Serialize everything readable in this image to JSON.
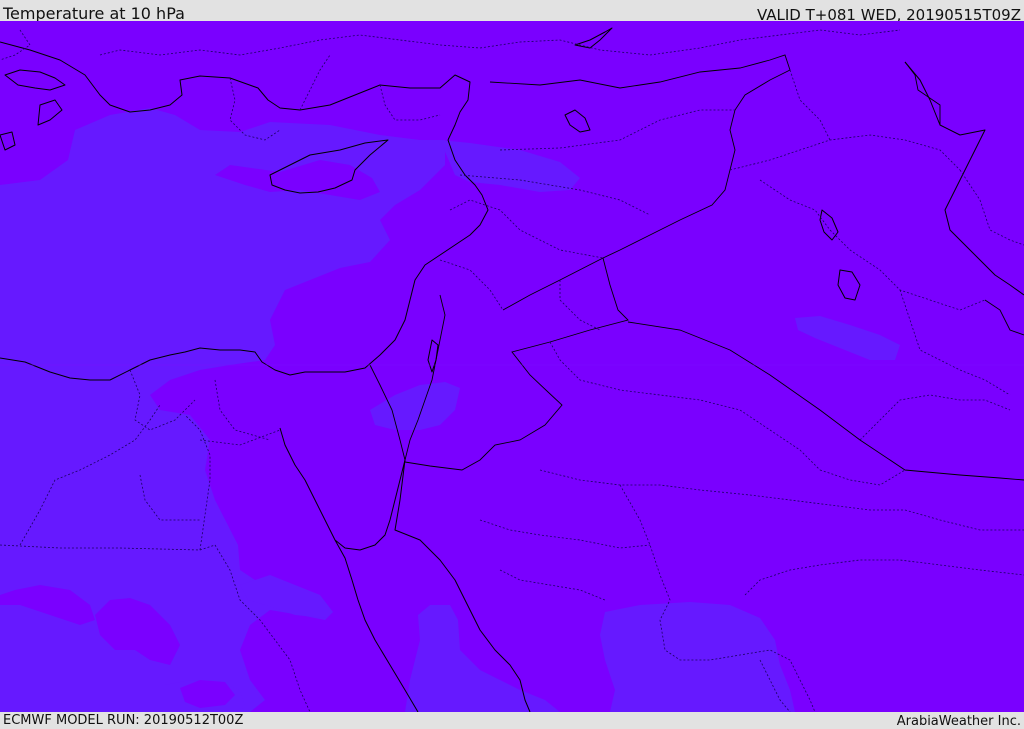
{
  "header": {
    "title": "Temperature at 10 hPa",
    "valid_time": "VALID T+081 WED, 20190515T09Z"
  },
  "footer": {
    "model_run": "ECMWF MODEL RUN: 20190512T00Z",
    "credit": "ArabiaWeather Inc."
  },
  "map": {
    "field": "Temperature",
    "level": "10 hPa",
    "colors": {
      "base_fill": "#7a00ff",
      "cooler_fill": "#6619ff",
      "coastline": "#000000",
      "border": "#1a0060"
    }
  }
}
